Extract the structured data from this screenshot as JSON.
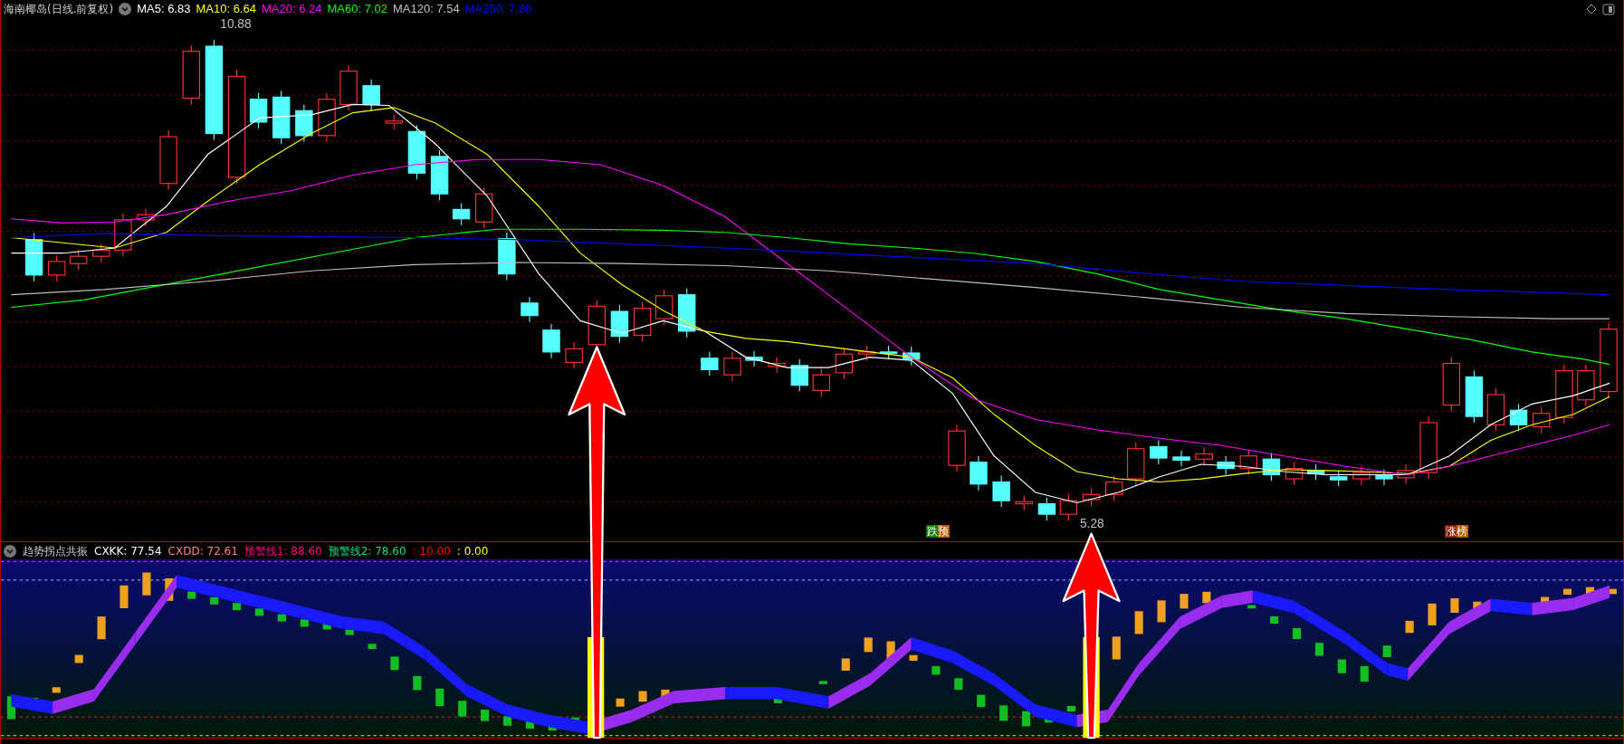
{
  "chart": {
    "title": "海南椰岛(日线.前复权)",
    "ma": [
      {
        "text": "MA5: 6.83",
        "color": "#ffffff"
      },
      {
        "text": "MA10: 6.64",
        "color": "#ffff00"
      },
      {
        "text": "MA20: 6.24",
        "color": "#ff00ff"
      },
      {
        "text": "MA60: 7.02",
        "color": "#00ff00"
      },
      {
        "text": "MA120: 7.54",
        "color": "#c0c0c0"
      },
      {
        "text": "MA250: 7.80",
        "color": "#0000ff"
      }
    ],
    "high_label": "10.88",
    "low_label": "5.28",
    "signals": [
      {
        "text": "跌预",
        "kind": "fall"
      },
      {
        "text": "涨榜",
        "kind": "rise"
      }
    ]
  },
  "indicator": {
    "title": "趋势拐点共振",
    "values": [
      {
        "text": "CXKK: 77.54",
        "color": "#ffffff"
      },
      {
        "text": "CXDD: 72.61",
        "color": "#ff8080"
      },
      {
        "text": "预警线1: 88.60",
        "color": "#ff0080"
      },
      {
        "text": "预警线2: 78.60",
        "color": "#00e080"
      },
      {
        "text": ": 10.00",
        "color": "#ff0000"
      },
      {
        "text": ": 0.00",
        "color": "#ffff00"
      }
    ]
  }
}
